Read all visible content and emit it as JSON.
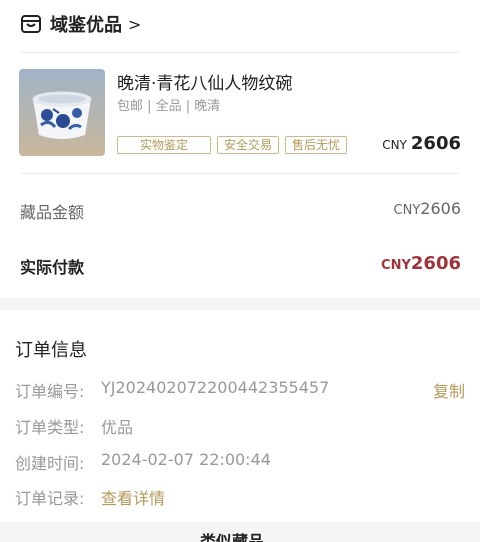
{
  "shop": {
    "name": "域鉴优品",
    "arrow": ">"
  },
  "product": {
    "title": "晚清·青花八仙人物纹碗",
    "subtitle": "包邮 | 全品 | 晚清",
    "tags": [
      "实物鉴定",
      "安全交易",
      "售后无忧"
    ],
    "currency": "CNY",
    "price": "2606"
  },
  "amounts": {
    "item_label": "藏品金额",
    "item_currency": "CNY",
    "item_value": "2606",
    "pay_label": "实际付款",
    "pay_currency": "CNY",
    "pay_value": "2606"
  },
  "order": {
    "section_title": "订单信息",
    "number_label": "订单编号:",
    "number_value": "YJ20240207220044235545 7",
    "copy_label": "复制",
    "type_label": "订单类型:",
    "type_value": "优品",
    "created_label": "创建时间:",
    "created_value": "2024-02-07 22:00:44",
    "record_label": "订单记录:",
    "record_link": "查看详情"
  },
  "bottom_partial": "类似藏品",
  "colors": {
    "accent": "#b69a5a",
    "pay": "#a0343a"
  }
}
